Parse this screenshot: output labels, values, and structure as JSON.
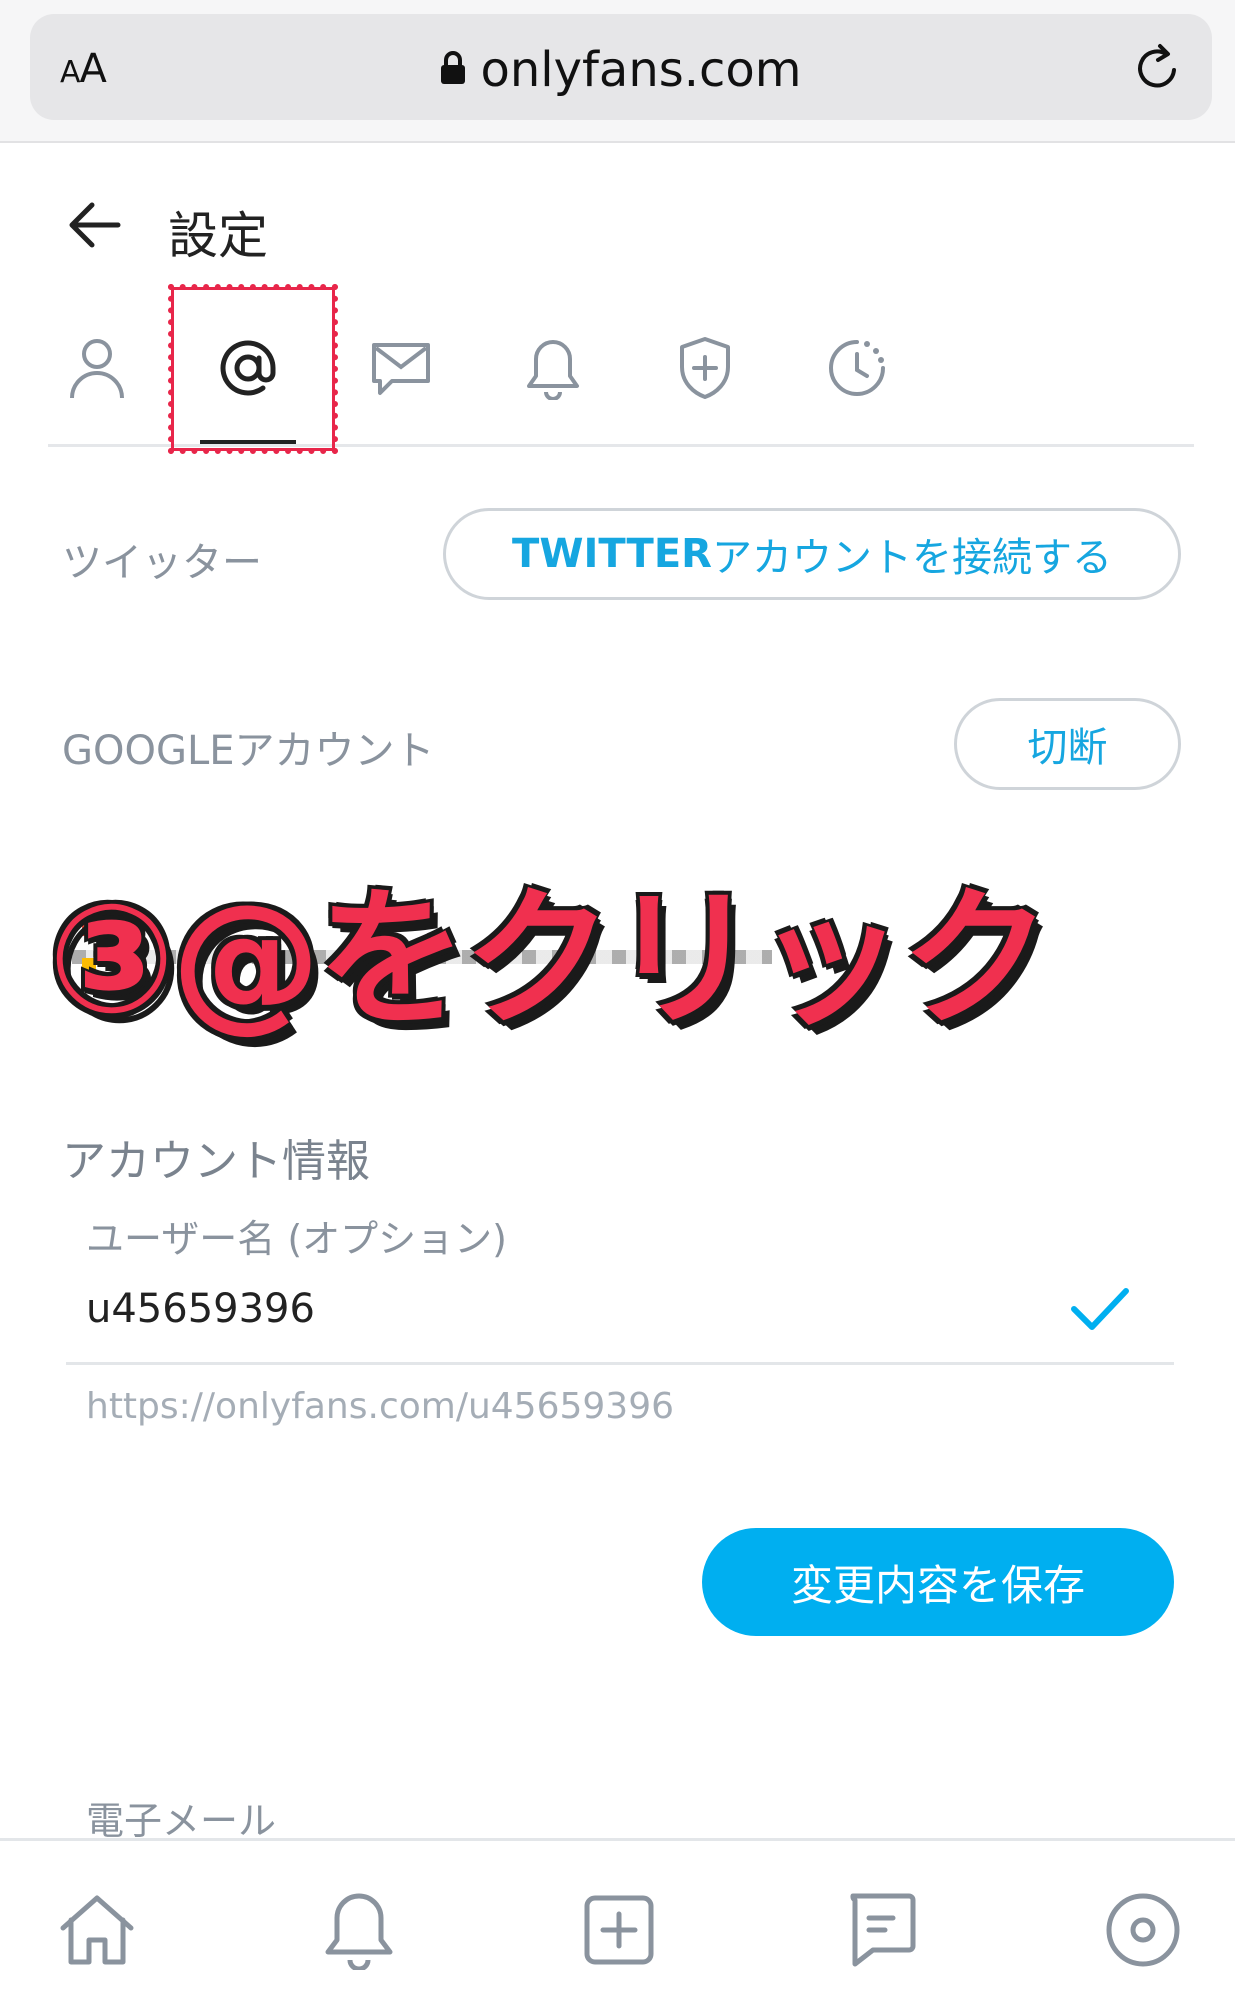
{
  "browser": {
    "text_size_label_small": "A",
    "text_size_label_large": "A",
    "url": "onlyfans.com"
  },
  "header": {
    "title": "設定"
  },
  "tabs": [
    {
      "name": "profile",
      "icon": "person-icon"
    },
    {
      "name": "account",
      "icon": "at-sign-icon",
      "active": true
    },
    {
      "name": "messages",
      "icon": "envelope-icon"
    },
    {
      "name": "notifications",
      "icon": "bell-icon"
    },
    {
      "name": "security",
      "icon": "shield-plus-icon"
    },
    {
      "name": "history",
      "icon": "clock-dotted-icon"
    }
  ],
  "twitter": {
    "label": "ツイッター",
    "button_bold": "TWITTER",
    "button_rest": "アカウントを接続する"
  },
  "google": {
    "label": "GOOGLEアカウント",
    "button": "切断"
  },
  "annotation": {
    "text": "③@をクリック"
  },
  "account_info": {
    "title": "アカウント情報",
    "username_label": "ユーザー名 (オプション)",
    "username_value": "u45659396",
    "profile_url": "https://onlyfans.com/u45659396"
  },
  "save_button": "変更内容を保存",
  "email_label": "電子メール",
  "colors": {
    "accent": "#00aff0",
    "highlight": "#e8264a"
  },
  "bottom_nav": [
    {
      "name": "home",
      "icon": "home-icon"
    },
    {
      "name": "notifications",
      "icon": "bell-icon"
    },
    {
      "name": "new-post",
      "icon": "plus-square-icon"
    },
    {
      "name": "messages",
      "icon": "chat-icon"
    },
    {
      "name": "profile",
      "icon": "user-circle-icon"
    }
  ]
}
